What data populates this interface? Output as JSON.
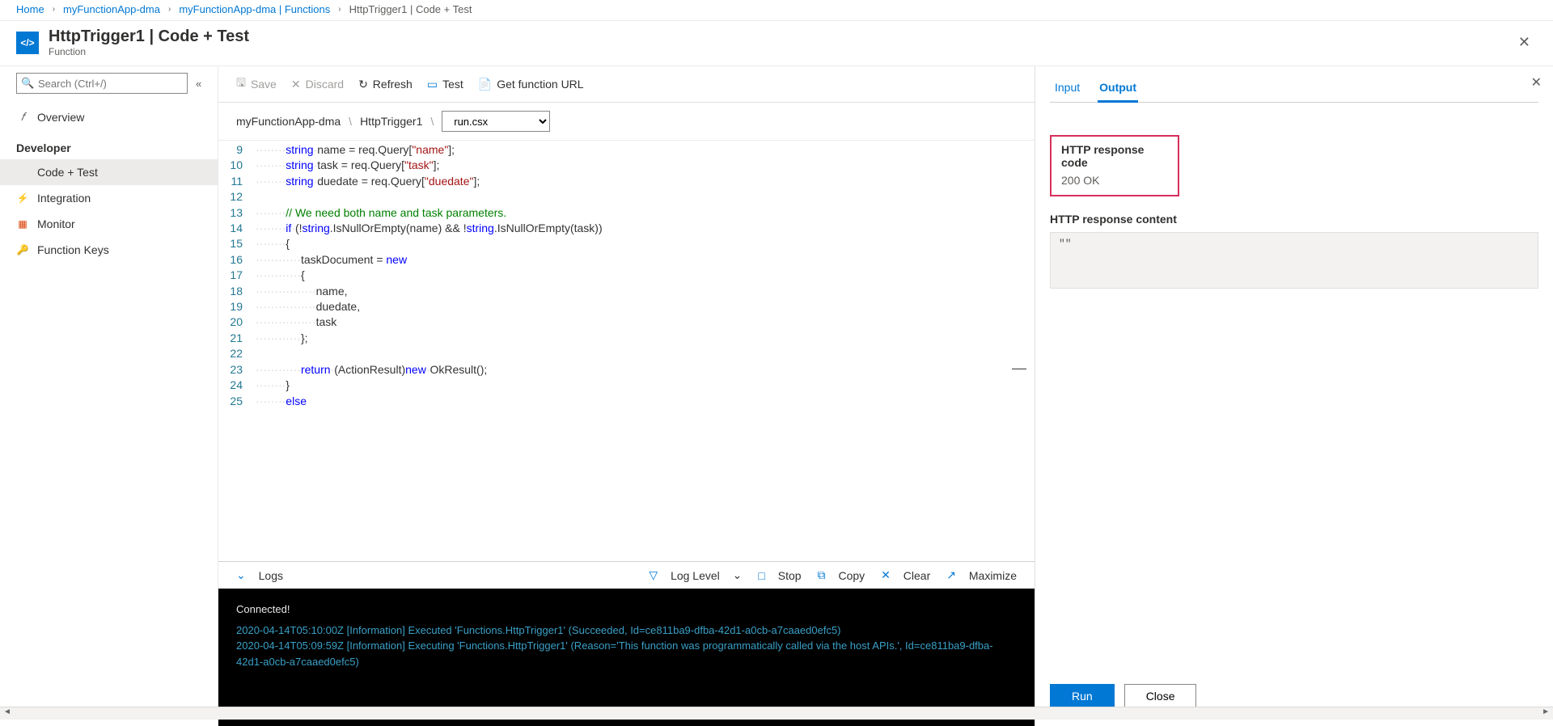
{
  "breadcrumb": {
    "items": [
      "Home",
      "myFunctionApp-dma",
      "myFunctionApp-dma | Functions",
      "HttpTrigger1 | Code + Test"
    ]
  },
  "header": {
    "title": "HttpTrigger1 | Code + Test",
    "subtitle": "Function",
    "badge": "</>"
  },
  "sidebar": {
    "search_placeholder": "Search (Ctrl+/)",
    "overview": "Overview",
    "dev_heading": "Developer",
    "items": [
      {
        "label": "Code + Test",
        "icon": "</>",
        "color": "#0078d4",
        "active": true
      },
      {
        "label": "Integration",
        "icon": "⚡",
        "color": "#f2a900",
        "active": false
      },
      {
        "label": "Monitor",
        "icon": "▦",
        "color": "#d83b01",
        "active": false
      },
      {
        "label": "Function Keys",
        "icon": "🔑",
        "color": "#ffb900",
        "active": false
      }
    ]
  },
  "toolbar": {
    "save": "Save",
    "discard": "Discard",
    "refresh": "Refresh",
    "test": "Test",
    "get_url": "Get function URL"
  },
  "path": {
    "app": "myFunctionApp-dma",
    "func": "HttpTrigger1",
    "file": "run.csx"
  },
  "code_lines": [
    {
      "n": 9,
      "html": "<span class='dots'>········</span><span class='kw'>string</span><span class='dots'>·</span><span class='cd'>name = req.Query[</span><span class='str'>\"name\"</span><span class='cd'>];</span>"
    },
    {
      "n": 10,
      "html": "<span class='dots'>········</span><span class='kw'>string</span><span class='dots'>·</span><span class='cd'>task = req.Query[</span><span class='str'>\"task\"</span><span class='cd'>];</span>"
    },
    {
      "n": 11,
      "html": "<span class='dots'>········</span><span class='kw'>string</span><span class='dots'>·</span><span class='cd'>duedate = req.Query[</span><span class='str'>\"duedate\"</span><span class='cd'>];</span>"
    },
    {
      "n": 12,
      "html": ""
    },
    {
      "n": 13,
      "html": "<span class='dots'>········</span><span class='cmt'>// We need both name and task parameters.</span>"
    },
    {
      "n": 14,
      "html": "<span class='dots'>········</span><span class='kw'>if</span><span class='dots'>·</span><span class='cd'>(!</span><span class='kw'>string</span><span class='cd'>.IsNullOrEmpty(name) &amp;&amp; !</span><span class='kw'>string</span><span class='cd'>.IsNullOrEmpty(task))</span>"
    },
    {
      "n": 15,
      "html": "<span class='dots'>········</span><span class='cd'>{</span>"
    },
    {
      "n": 16,
      "html": "<span class='dots'>············</span><span class='cd'>taskDocument = </span><span class='kw'>new</span>"
    },
    {
      "n": 17,
      "html": "<span class='dots'>············</span><span class='cd'>{</span>"
    },
    {
      "n": 18,
      "html": "<span class='dots'>················</span><span class='cd'>name,</span>"
    },
    {
      "n": 19,
      "html": "<span class='dots'>················</span><span class='cd'>duedate,</span>"
    },
    {
      "n": 20,
      "html": "<span class='dots'>················</span><span class='cd'>task</span>"
    },
    {
      "n": 21,
      "html": "<span class='dots'>············</span><span class='cd'>};</span>"
    },
    {
      "n": 22,
      "html": ""
    },
    {
      "n": 23,
      "html": "<span class='dots'>············</span><span class='kw'>return</span><span class='dots'>·</span><span class='cd'>(ActionResult)</span><span class='kw'>new</span><span class='dots'>·</span><span class='cd'>OkResult();</span>"
    },
    {
      "n": 24,
      "html": "<span class='dots'>········</span><span class='cd'>}</span>"
    },
    {
      "n": 25,
      "html": "<span class='dots'>········</span><span class='kw'>else</span>"
    }
  ],
  "logs": {
    "label": "Logs",
    "loglevel": "Log Level",
    "stop": "Stop",
    "copy": "Copy",
    "clear": "Clear",
    "maximize": "Maximize",
    "connected": "Connected!",
    "lines": [
      "2020-04-14T05:10:00Z   [Information]   Executed 'Functions.HttpTrigger1' (Succeeded, Id=ce811ba9-dfba-42d1-a0cb-a7caaed0efc5)",
      "2020-04-14T05:09:59Z   [Information]   Executing 'Functions.HttpTrigger1' (Reason='This function was programmatically called via the host APIs.', Id=ce811ba9-dfba-42d1-a0cb-a7caaed0efc5)"
    ]
  },
  "output": {
    "tab_input": "Input",
    "tab_output": "Output",
    "resp_code_label": "HTTP response code",
    "resp_code_value": "200 OK",
    "resp_content_label": "HTTP response content",
    "resp_content_value": "\"\"",
    "run": "Run",
    "close": "Close"
  }
}
